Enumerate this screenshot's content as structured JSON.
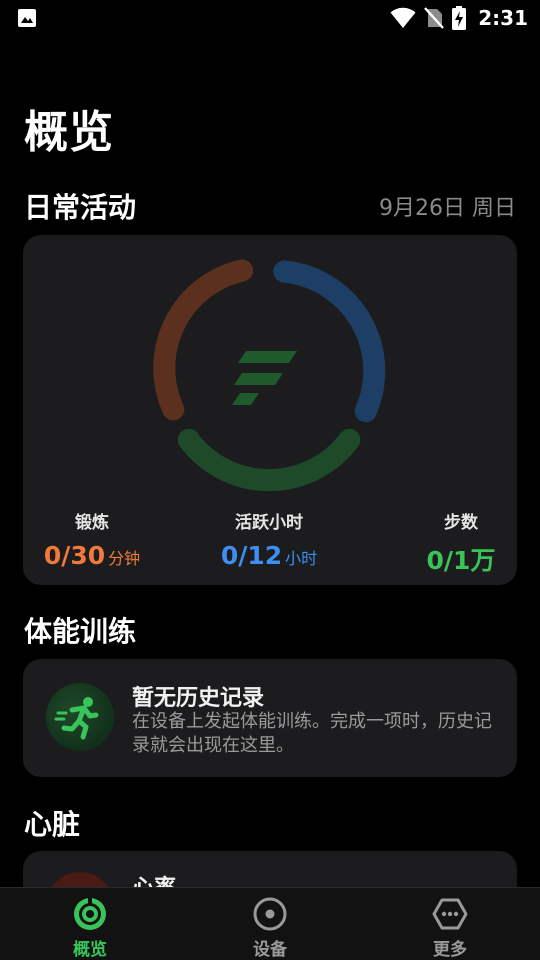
{
  "status_bar": {
    "time": "2:31"
  },
  "page_title": "概览",
  "daily_activity": {
    "title": "日常活动",
    "date": "9月26日 周日",
    "stats": [
      {
        "label": "锻炼",
        "value": "0/30",
        "unit": "分钟",
        "color": "#f07a3a"
      },
      {
        "label": "活跃小时",
        "value": "0/12",
        "unit": "小时",
        "color": "#3d8ef0"
      },
      {
        "label": "步数",
        "value": "0/1万",
        "unit": "",
        "color": "#39c45a"
      }
    ],
    "ring_colors": {
      "exercise": "#5b301f",
      "active": "#1d3f66",
      "steps": "#1e4a29"
    }
  },
  "fitness": {
    "title": "体能训练",
    "empty_title": "暂无历史记录",
    "empty_desc": "在设备上发起体能训练。完成一项时，历史记录就会出现在这里。"
  },
  "heart": {
    "title": "心脏",
    "item_title": "心率"
  },
  "nav": {
    "items": [
      {
        "label": "概览",
        "icon": "overview-icon",
        "active": true
      },
      {
        "label": "设备",
        "icon": "device-icon",
        "active": false
      },
      {
        "label": "更多",
        "icon": "more-icon",
        "active": false
      }
    ],
    "active_color": "#39c45a",
    "inactive_color": "#9a9a9a"
  }
}
